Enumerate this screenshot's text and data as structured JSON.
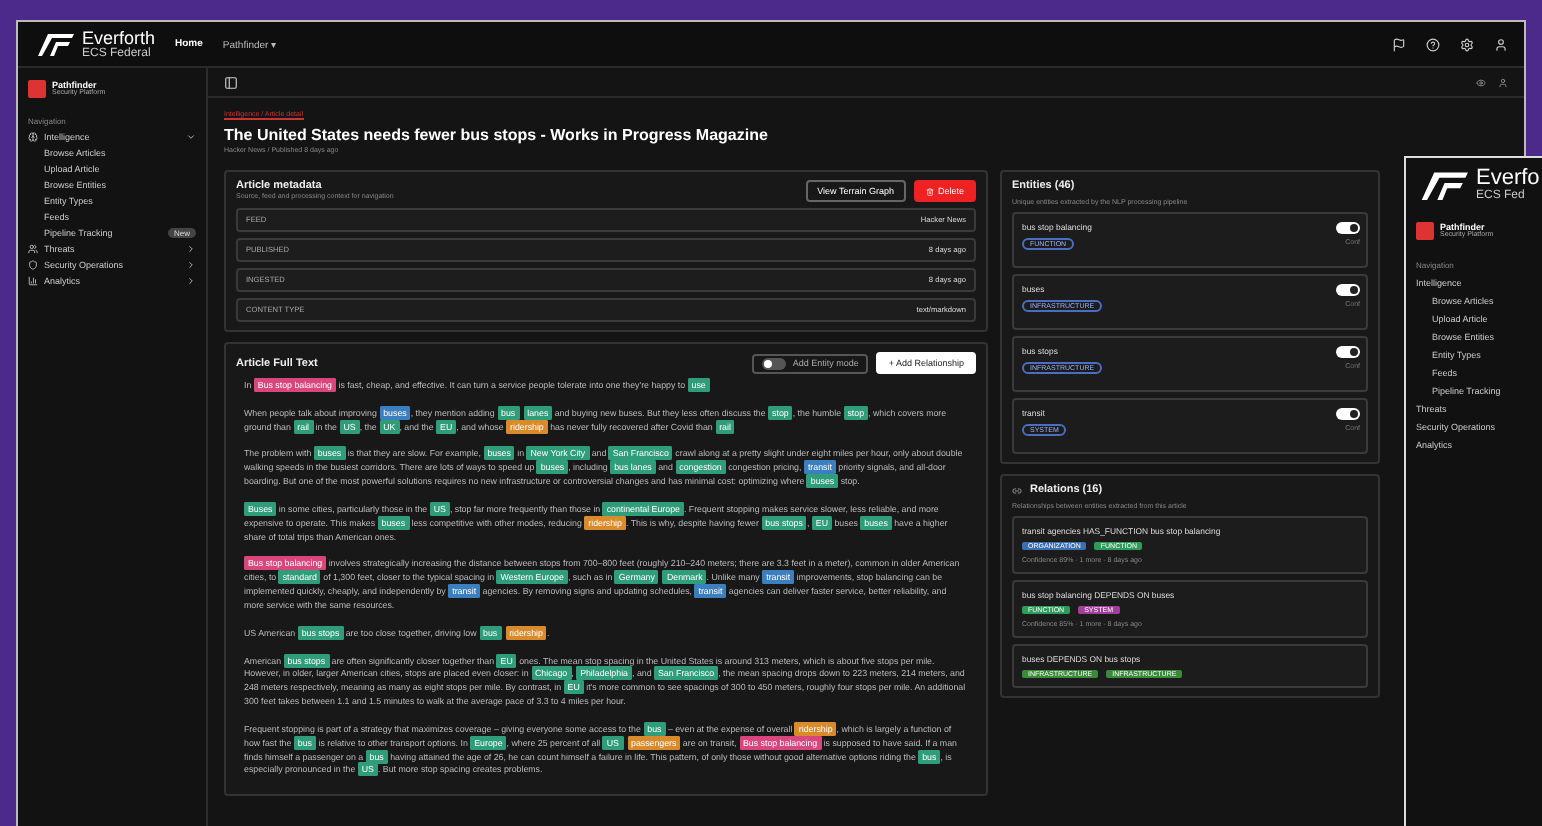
{
  "topbar": {
    "brand": "Everforth",
    "brand_sub": "ECS Federal",
    "nav": [
      {
        "label": "Home",
        "selected": true
      },
      {
        "label": "Pathfinder ▾",
        "selected": false
      }
    ]
  },
  "sidebar": {
    "app": "Pathfinder",
    "app_sub": "Security Platform",
    "section": "Navigation",
    "items": [
      {
        "label": "Intelligence",
        "expanded": true,
        "children": [
          {
            "label": "Browse Articles"
          },
          {
            "label": "Upload Article"
          },
          {
            "label": "Browse Entities"
          },
          {
            "label": "Entity Types"
          },
          {
            "label": "Feeds"
          },
          {
            "label": "Pipeline Tracking",
            "badge": "New"
          }
        ]
      },
      {
        "label": "Threats",
        "expanded": false
      },
      {
        "label": "Security Operations",
        "expanded": false
      },
      {
        "label": "Analytics",
        "expanded": false
      }
    ]
  },
  "page": {
    "kicker": "Intelligence / Article detail",
    "title": "The United States needs fewer bus stops - Works in Progress Magazine",
    "subtitle": "Hacker News / Published 8 days ago"
  },
  "metadata": {
    "title": "Article metadata",
    "subtitle": "Source, feed and processing context for navigation",
    "buttons": [
      {
        "label": "View Terrain Graph",
        "kind": "outline"
      },
      {
        "label": "Delete",
        "kind": "danger"
      }
    ],
    "rows": [
      {
        "label": "FEED",
        "value": "Hacker News"
      },
      {
        "label": "PUBLISHED",
        "value": "8 days ago"
      },
      {
        "label": "INGESTED",
        "value": "8 days ago"
      },
      {
        "label": "CONTENT TYPE",
        "value": "text/markdown"
      }
    ]
  },
  "fulltext": {
    "title": "Article Full Text",
    "entity_mode": {
      "label": "Add Entity mode",
      "on": false
    },
    "add_button": "+ Add Relationship",
    "paragraphs": [
      [
        {
          "text": "In "
        },
        {
          "text": "Bus stop balancing",
          "color": "#d9467e"
        },
        {
          "text": " is fast, cheap, and effective. It can turn a service people tolerate into one they're happy to "
        },
        {
          "text": "use",
          "color": "#2f9c7a"
        }
      ],
      [
        {
          "text": "When people talk about improving "
        },
        {
          "text": "buses",
          "color": "#3b7fbf"
        },
        {
          "text": ", they mention adding "
        },
        {
          "text": "bus",
          "color": "#2f9c7a"
        },
        {
          "text": "lanes",
          "color": "#2f9c7a"
        },
        {
          "text": " and buying new buses. But they less often discuss the "
        },
        {
          "text": "stop",
          "color": "#2f9c7a"
        },
        {
          "text": ", the humble "
        },
        {
          "text": "stop",
          "color": "#2f9c7a"
        },
        {
          "text": ", which covers more ground than "
        },
        {
          "text": "rail",
          "color": "#2f9c7a"
        },
        {
          "text": " in the "
        },
        {
          "text": "US",
          "color": "#2f9c7a"
        },
        {
          "text": ", the "
        },
        {
          "text": "UK",
          "color": "#2f9c7a"
        },
        {
          "text": ", and the "
        },
        {
          "text": "EU",
          "color": "#2f9c7a"
        },
        {
          "text": ", and whose "
        },
        {
          "text": "ridership",
          "color": "#d98a2a"
        },
        {
          "text": " has never fully recovered after Covid than "
        },
        {
          "text": "rail",
          "color": "#2f9c7a"
        }
      ],
      [
        {
          "text": "The problem with "
        },
        {
          "text": "buses",
          "color": "#2f9c7a"
        },
        {
          "text": " is that they are slow. For example, "
        },
        {
          "text": "buses",
          "color": "#2f9c7a"
        },
        {
          "text": " in "
        },
        {
          "text": "New York City",
          "color": "#2f9c7a"
        },
        {
          "text": " and "
        },
        {
          "text": "San Francisco",
          "color": "#2f9c7a"
        },
        {
          "text": " crawl along at a pretty slight under eight miles per hour, only about double walking speeds in the busiest corridors. There are lots of ways to speed up "
        },
        {
          "text": "buses",
          "color": "#2f9c7a"
        },
        {
          "text": ", including "
        },
        {
          "text": "bus lanes",
          "color": "#2f9c7a"
        },
        {
          "text": " and "
        },
        {
          "text": "congestion",
          "color": "#2f9c7a"
        },
        {
          "text": " congestion pricing, "
        },
        {
          "text": "transit",
          "color": "#3b7fbf"
        },
        {
          "text": " priority signals, and all-door boarding. But one of the most powerful solutions requires no new infrastructure or controversial changes and has minimal cost: optimizing where "
        },
        {
          "text": "buses",
          "color": "#2f9c7a"
        },
        {
          "text": " stop."
        }
      ],
      [
        {
          "text": "Buses",
          "color": "#2f9c7a"
        },
        {
          "text": " in some cities, particularly those in the "
        },
        {
          "text": "US",
          "color": "#2f9c7a"
        },
        {
          "text": ", stop far more frequently than those in "
        },
        {
          "text": "continental Europe",
          "color": "#2f9c7a"
        },
        {
          "text": ". Frequent stopping makes service slower, less reliable, and more expensive to operate. This makes "
        },
        {
          "text": "buses",
          "color": "#2f9c7a"
        },
        {
          "text": " less competitive with other modes, reducing "
        },
        {
          "text": "ridership",
          "color": "#d98a2a"
        },
        {
          "text": ". This is why, despite having fewer "
        },
        {
          "text": "bus stops",
          "color": "#2f9c7a"
        },
        {
          "text": ", "
        },
        {
          "text": "EU",
          "color": "#2f9c7a"
        },
        {
          "text": " buses "
        },
        {
          "text": "buses",
          "color": "#2f9c7a"
        },
        {
          "text": " have a higher share of total trips than American ones."
        }
      ],
      [
        {
          "text": "Bus stop balancing",
          "color": "#d9467e"
        },
        {
          "text": " involves strategically increasing the distance between stops from 700–800 feet (roughly 210–240 meters; there are 3.3 feet in a meter), common in older American cities, to "
        },
        {
          "text": "standard",
          "color": "#2f9c7a"
        },
        {
          "text": " of 1,300 feet, closer to the typical spacing in "
        },
        {
          "text": "Western Europe",
          "color": "#2f9c7a"
        },
        {
          "text": ", such as in "
        },
        {
          "text": "Germany",
          "color": "#2f9c7a"
        },
        {
          "text": "Denmark",
          "color": "#2f9c7a"
        },
        {
          "text": ". Unlike many "
        },
        {
          "text": "transit",
          "color": "#3b7fbf"
        },
        {
          "text": " improvements, stop balancing can be implemented quickly, cheaply, and independently by "
        },
        {
          "text": "transit",
          "color": "#3b7fbf"
        },
        {
          "text": " agencies. By removing signs and updating schedules, "
        },
        {
          "text": "transit",
          "color": "#3b7fbf"
        },
        {
          "text": " agencies can deliver faster service, better reliability, and more service with the same resources."
        }
      ],
      [
        {
          "text": "US American "
        },
        {
          "text": "bus stops",
          "color": "#2f9c7a"
        },
        {
          "text": " are too close together, driving low "
        },
        {
          "text": "bus",
          "color": "#2f9c7a"
        },
        {
          "text": "ridership",
          "color": "#d98a2a"
        },
        {
          "text": "."
        }
      ],
      [
        {
          "text": "American "
        },
        {
          "text": "bus stops",
          "color": "#2f9c7a"
        },
        {
          "text": " are often significantly closer together than "
        },
        {
          "text": "EU",
          "color": "#2f9c7a"
        },
        {
          "text": " ones. The mean stop spacing in the United States is around 313 meters, which is about five stops per mile. However, in older, larger American cities, stops are placed even closer: in "
        },
        {
          "text": "Chicago",
          "color": "#2f9c7a"
        },
        {
          "text": ", "
        },
        {
          "text": "Philadelphia",
          "color": "#2f9c7a"
        },
        {
          "text": ", and "
        },
        {
          "text": "San Francisco",
          "color": "#2f9c7a"
        },
        {
          "text": ", the mean spacing drops down to 223 meters, 214 meters, and 248 meters respectively, meaning as many as eight stops per mile. By contrast, in "
        },
        {
          "text": "EU",
          "color": "#2f9c7a"
        },
        {
          "text": " it's more common to see spacings of 300 to 450 meters, roughly four stops per mile. An additional 300 feet takes between 1.1 and 1.5 minutes to walk at the average pace of 3.3 to 4 miles per hour."
        }
      ],
      [
        {
          "text": "Frequent stopping is part of a strategy that maximizes coverage – giving everyone some access to the "
        },
        {
          "text": "bus",
          "color": "#2f9c7a"
        },
        {
          "text": " – even at the expense of overall "
        },
        {
          "text": "ridership",
          "color": "#d98a2a"
        },
        {
          "text": ", which is largely a function of how fast the "
        },
        {
          "text": "bus",
          "color": "#2f9c7a"
        },
        {
          "text": " is relative to other transport options. In "
        },
        {
          "text": "Europe",
          "color": "#2f9c7a"
        },
        {
          "text": ", where 25 percent of all "
        },
        {
          "text": "US",
          "color": "#2f9c7a"
        },
        {
          "text": "passengers",
          "color": "#d98a2a"
        },
        {
          "text": " are on transit, "
        },
        {
          "text": "Bus stop balancing",
          "color": "#d9467e"
        },
        {
          "text": " is supposed to have said. If a man finds himself a passenger on a "
        },
        {
          "text": "bus",
          "color": "#2f9c7a"
        },
        {
          "text": " having attained the age of 26, he can count himself a failure in life. This pattern, of only those without good alternative options riding the "
        },
        {
          "text": "bus",
          "color": "#2f9c7a"
        },
        {
          "text": ", is especially pronounced in the "
        },
        {
          "text": "US",
          "color": "#2f9c7a"
        },
        {
          "text": ". But more stop spacing creates problems."
        }
      ]
    ]
  },
  "entities": {
    "title": "Entities (46)",
    "subtitle": "Unique entities extracted by the NLP processing pipeline",
    "items": [
      {
        "name": "bus stop balancing",
        "type": "FUNCTION",
        "on": true,
        "note": "Conf"
      },
      {
        "name": "buses",
        "type": "INFRASTRUCTURE",
        "on": true,
        "note": "Conf"
      },
      {
        "name": "bus stops",
        "type": "INFRASTRUCTURE",
        "on": true,
        "note": "Conf"
      },
      {
        "name": "transit",
        "type": "SYSTEM",
        "on": true,
        "note": "Conf"
      }
    ]
  },
  "relations": {
    "title": "Relations (16)",
    "subtitle": "Relationships between entities extracted from this article",
    "items": [
      {
        "text": "transit agencies HAS_FUNCTION bus stop balancing",
        "tags": [
          {
            "label": "ORGANIZATION",
            "color": "#3b6fb0"
          },
          {
            "label": "FUNCTION",
            "color": "#2f9c5a"
          }
        ],
        "meta": "Confidence 89% · 1 more · 8 days ago"
      },
      {
        "text": "bus stop balancing DEPENDS ON buses",
        "tags": [
          {
            "label": "FUNCTION",
            "color": "#2f9c5a"
          },
          {
            "label": "SYSTEM",
            "color": "#a0409a"
          }
        ],
        "meta": "Confidence 85% · 1 more · 8 days ago"
      },
      {
        "text": "buses DEPENDS ON bus stops",
        "tags": [
          {
            "label": "INFRASTRUCTURE",
            "color": "#3a8a3a"
          },
          {
            "label": "INFRASTRUCTURE",
            "color": "#3a8a3a"
          }
        ]
      }
    ]
  },
  "overlay": {
    "brand": "Everfo",
    "brand_sub": "ECS Fed",
    "app": "Pathfinder",
    "app_sub": "Security Platform",
    "section": "Navigation",
    "items": [
      {
        "label": "Intelligence",
        "children": [
          {
            "label": "Browse Articles"
          },
          {
            "label": "Upload Article"
          },
          {
            "label": "Browse Entities"
          },
          {
            "label": "Entity Types"
          },
          {
            "label": "Feeds"
          },
          {
            "label": "Pipeline Tracking"
          }
        ]
      },
      {
        "label": "Threats"
      },
      {
        "label": "Security Operations"
      },
      {
        "label": "Analytics"
      }
    ]
  }
}
